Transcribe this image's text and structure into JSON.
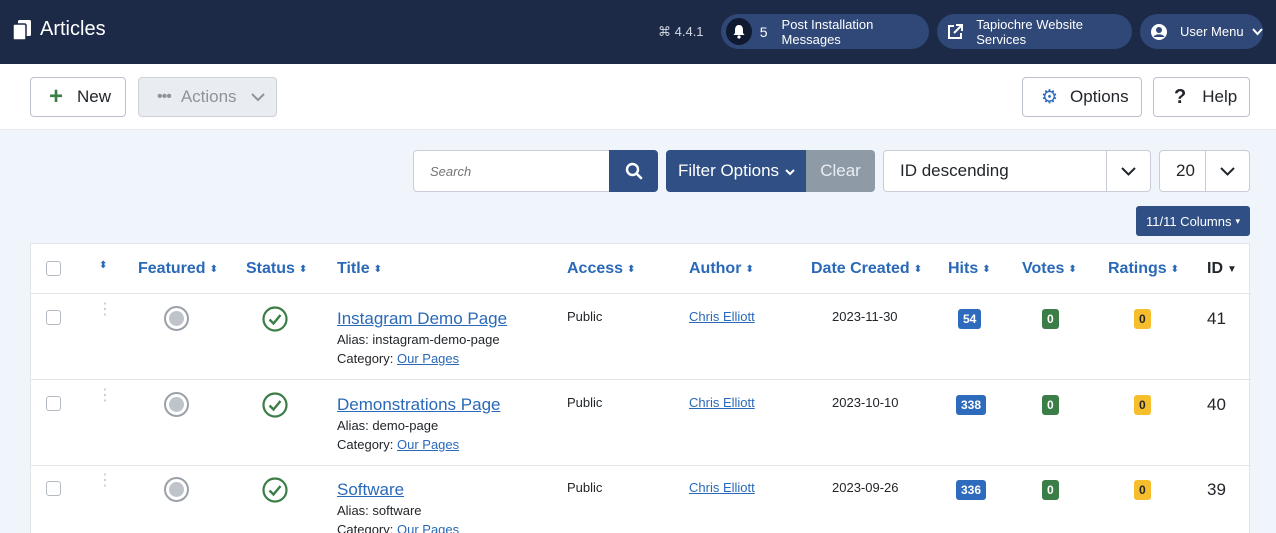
{
  "header": {
    "title": "Articles",
    "version": "4.4.1",
    "notifications_count": "5",
    "post_install_label": "Post Installation Messages",
    "site_label": "Tapiochre Website Services",
    "user_menu_label": "User Menu"
  },
  "toolbar": {
    "new_label": "New",
    "actions_label": "Actions",
    "options_label": "Options",
    "help_label": "Help"
  },
  "filters": {
    "search_placeholder": "Search",
    "filter_options_label": "Filter Options",
    "clear_label": "Clear",
    "ordering_value": "ID descending",
    "limit_value": "20",
    "columns_label": "11/11 Columns"
  },
  "table": {
    "headers": {
      "featured": "Featured",
      "status": "Status",
      "title": "Title",
      "access": "Access",
      "author": "Author",
      "date_created": "Date Created",
      "hits": "Hits",
      "votes": "Votes",
      "ratings": "Ratings",
      "id": "ID"
    },
    "rows": [
      {
        "title": "Instagram Demo Page",
        "alias": "Alias: instagram-demo-page",
        "category_prefix": "Category:",
        "category": "Our Pages",
        "access": "Public",
        "author": "Chris Elliott",
        "date": "2023-11-30",
        "hits": "54",
        "votes": "0",
        "ratings": "0",
        "id": "41"
      },
      {
        "title": "Demonstrations Page",
        "alias": "Alias: demo-page",
        "category_prefix": "Category:",
        "category": "Our Pages",
        "access": "Public",
        "author": "Chris Elliott",
        "date": "2023-10-10",
        "hits": "338",
        "votes": "0",
        "ratings": "0",
        "id": "40"
      },
      {
        "title": "Software",
        "alias": "Alias: software",
        "category_prefix": "Category:",
        "category": "Our Pages",
        "access": "Public",
        "author": "Chris Elliott",
        "date": "2023-09-26",
        "hits": "336",
        "votes": "0",
        "ratings": "0",
        "id": "39"
      }
    ]
  }
}
